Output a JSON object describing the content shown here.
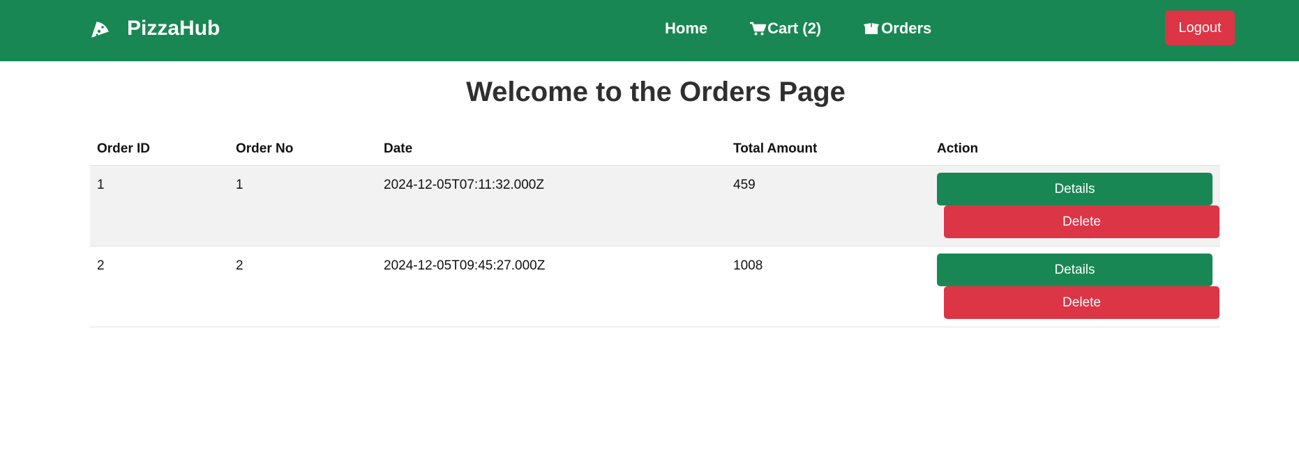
{
  "navbar": {
    "brand_icon": "pizza-slice-icon",
    "brand_name": "PizzaHub",
    "links": [
      {
        "label": "Home",
        "icon": ""
      },
      {
        "label": "Cart (2)",
        "icon": "cart-icon"
      },
      {
        "label": "Orders",
        "icon": "box-icon"
      }
    ],
    "logout_label": "Logout"
  },
  "page": {
    "title": "Welcome to the Orders Page"
  },
  "orders_table": {
    "headers": [
      "Order ID",
      "Order No",
      "Date",
      "Total Amount",
      "Action"
    ],
    "rows": [
      {
        "order_id": "1",
        "order_no": "1",
        "date": "2024-12-05T07:11:32.000Z",
        "total": "459",
        "details_label": "Details",
        "delete_label": "Delete"
      },
      {
        "order_id": "2",
        "order_no": "2",
        "date": "2024-12-05T09:45:27.000Z",
        "total": "1008",
        "details_label": "Details",
        "delete_label": "Delete"
      }
    ]
  },
  "colors": {
    "primary_green": "#198754",
    "danger_red": "#dc3545",
    "stripe_gray": "#f2f2f2"
  }
}
